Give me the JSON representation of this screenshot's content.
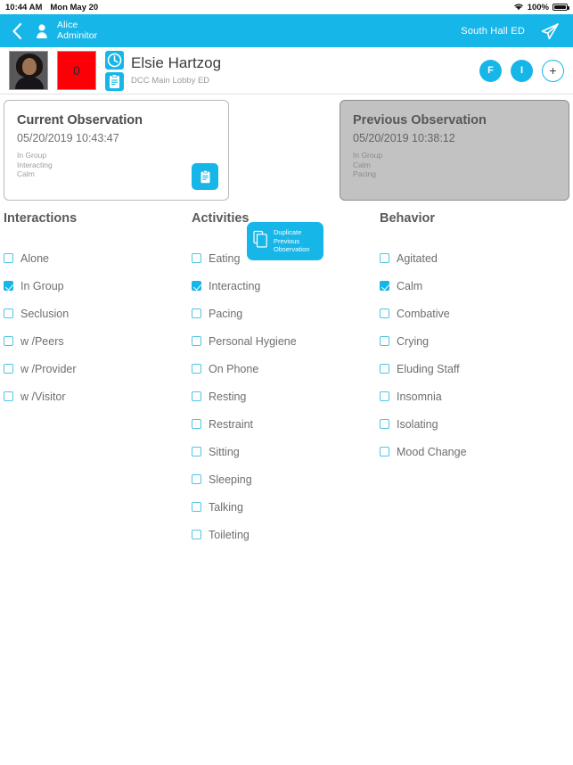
{
  "status_bar": {
    "time": "10:44 AM",
    "date": "Mon May 20",
    "battery_percent": "100%",
    "wifi_icon": "wifi-icon",
    "battery_icon": "battery-icon"
  },
  "nav_bar": {
    "back_icon": "back-chevron-icon",
    "user_icon": "person-icon",
    "user_first_line": "Alice",
    "user_second_line": "Adminitor",
    "location": "South Hall ED",
    "send_icon": "send-icon",
    "background_color": "#17b6e8"
  },
  "patient_header": {
    "avatar_name": "patient-avatar",
    "count_badge": "0",
    "count_badge_color": "#fb0007",
    "clock_icon": "clock-icon",
    "clipboard_icon": "clipboard-icon",
    "name": "Elsie Hartzog",
    "unit": "DCC Main Lobby ED",
    "actions": [
      {
        "label": "F",
        "name": "flag-button",
        "style": "filled"
      },
      {
        "label": "I",
        "name": "info-button",
        "style": "filled"
      },
      {
        "label": "+",
        "name": "add-button",
        "style": "outline"
      }
    ]
  },
  "current_observation": {
    "title": "Current Observation",
    "timestamp": "05/20/2019 10:43:47",
    "tags": [
      "In Group",
      "Interacting",
      "Calm"
    ],
    "clipboard_icon": "clipboard-icon"
  },
  "previous_observation": {
    "title": "Previous Observation",
    "timestamp": "05/20/2019 10:38:12",
    "tags": [
      "In Group",
      "Calm",
      "Pacing"
    ]
  },
  "duplicate_button": {
    "icon": "copy-pages-icon",
    "line1": "Duplicate",
    "line2": "Previous",
    "line3": "Observation"
  },
  "columns": [
    {
      "header": "Interactions",
      "items": [
        {
          "label": "Alone",
          "checked": false
        },
        {
          "label": "In Group",
          "checked": true
        },
        {
          "label": "Seclusion",
          "checked": false
        },
        {
          "label": "w /Peers",
          "checked": false
        },
        {
          "label": "w /Provider",
          "checked": false
        },
        {
          "label": "w /Visitor",
          "checked": false
        }
      ]
    },
    {
      "header": "Activities",
      "items": [
        {
          "label": "Eating",
          "checked": false
        },
        {
          "label": "Interacting",
          "checked": true
        },
        {
          "label": "Pacing",
          "checked": false
        },
        {
          "label": "Personal Hygiene",
          "checked": false
        },
        {
          "label": "On Phone",
          "checked": false
        },
        {
          "label": "Resting",
          "checked": false
        },
        {
          "label": "Restraint",
          "checked": false
        },
        {
          "label": "Sitting",
          "checked": false
        },
        {
          "label": "Sleeping",
          "checked": false
        },
        {
          "label": "Talking",
          "checked": false
        },
        {
          "label": "Toileting",
          "checked": false
        }
      ]
    },
    {
      "header": "Behavior",
      "items": [
        {
          "label": "Agitated",
          "checked": false
        },
        {
          "label": "Calm",
          "checked": true
        },
        {
          "label": "Combative",
          "checked": false
        },
        {
          "label": "Crying",
          "checked": false
        },
        {
          "label": "Eluding Staff",
          "checked": false
        },
        {
          "label": "Insomnia",
          "checked": false
        },
        {
          "label": "Isolating",
          "checked": false
        },
        {
          "label": "Mood Change",
          "checked": false
        }
      ]
    }
  ],
  "theme": {
    "accent": "#17b6e8",
    "checkbox_border": "#4fc4ea",
    "text": "#6e6e6e"
  }
}
